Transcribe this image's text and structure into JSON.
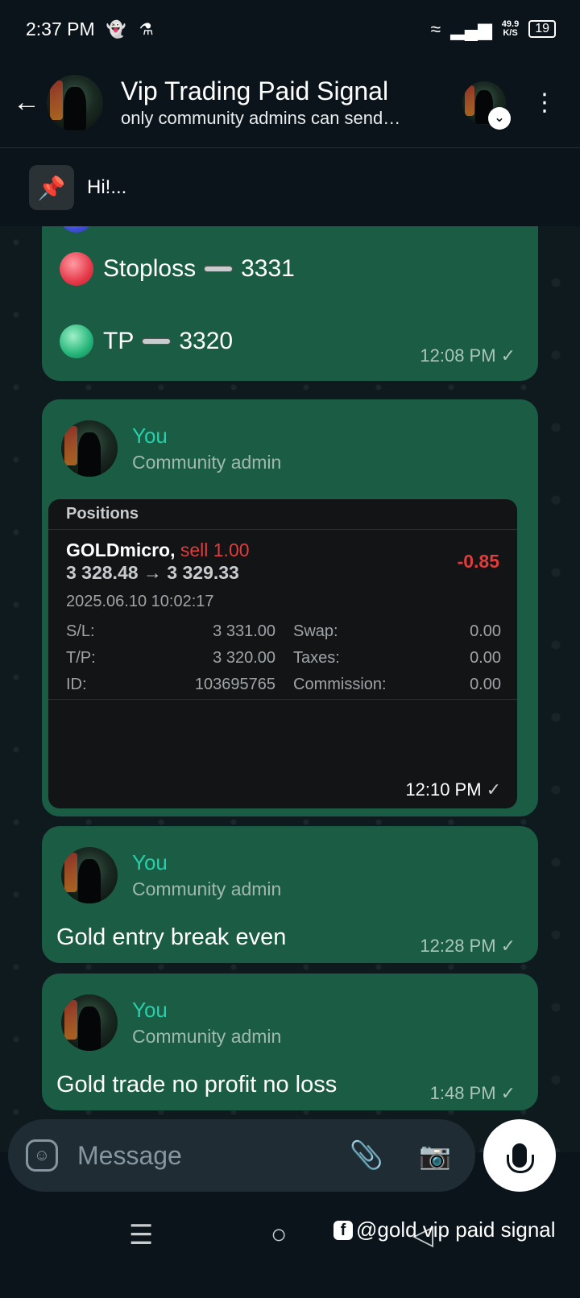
{
  "status_bar": {
    "time": "2:37 PM",
    "snapchat_icon": "ghost-icon",
    "lab_icon": "flask-icon",
    "net_speed_value": "49.9",
    "net_speed_unit": "K/S",
    "battery": "19"
  },
  "header": {
    "title": "Vip Trading Paid Signal",
    "subtitle": "only community admins can send…"
  },
  "pinned": {
    "text": "Hi!..."
  },
  "messages": [
    {
      "rows": [
        {
          "label": "Stoploss",
          "value": "3331"
        },
        {
          "label": "TP",
          "value": "3320"
        }
      ],
      "time": "12:08 PM"
    },
    {
      "sender": "You",
      "role": "Community admin",
      "card": {
        "header": "Positions",
        "symbol": "GOLDmicro,",
        "side": "sell 1.00",
        "prices": "3 328.48 → 3 329.33",
        "pl": "-0.85",
        "date": "2025.06.10 10:02:17",
        "grid": [
          {
            "k1": "S/L:",
            "v1": "3 331.00",
            "k2": "Swap:",
            "v2": "0.00"
          },
          {
            "k1": "T/P:",
            "v1": "3 320.00",
            "k2": "Taxes:",
            "v2": "0.00"
          },
          {
            "k1": "ID:",
            "v1": "103695765",
            "k2": "Commission:",
            "v2": "0.00"
          }
        ]
      },
      "time": "12:10 PM"
    },
    {
      "sender": "You",
      "role": "Community admin",
      "text": "Gold entry break even",
      "time": "12:28 PM"
    },
    {
      "sender": "You",
      "role": "Community admin",
      "text": "Gold trade no profit no loss",
      "time": "1:48 PM"
    }
  ],
  "input": {
    "placeholder": "Message"
  },
  "watermark": "@gold vip paid signal"
}
